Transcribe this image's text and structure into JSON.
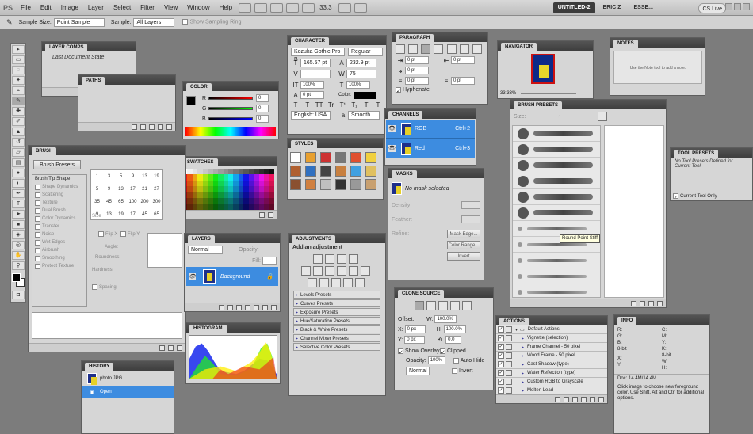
{
  "app": {
    "logo": "PS",
    "menu": [
      "File",
      "Edit",
      "Image",
      "Layer",
      "Select",
      "Filter",
      "View",
      "Window",
      "Help"
    ],
    "zoom": "33.3",
    "workspaces": [
      "UNTITLED-2",
      "ERIC Z",
      "ESSE..."
    ],
    "cslive": "CS Live"
  },
  "options": {
    "sample_size_label": "Sample Size:",
    "sample_size_value": "Point Sample",
    "sample_label": "Sample:",
    "sample_value": "All Layers",
    "show_ring": "Show Sampling Ring"
  },
  "layer_comps": {
    "title": "LAYER COMPS",
    "state": "Last Document State"
  },
  "paths": {
    "title": "PATHS"
  },
  "color": {
    "title": "COLOR",
    "values": [
      "0",
      "0",
      "0"
    ],
    "labels": [
      "R",
      "G",
      "B"
    ]
  },
  "swatches": {
    "title": "SWATCHES"
  },
  "brush": {
    "title": "BRUSH",
    "presets_button": "Brush Presets",
    "items": [
      "Brush Tip Shape",
      "Shape Dynamics",
      "Scattering",
      "Texture",
      "Dual Brush",
      "Color Dynamics",
      "Transfer",
      "Noise",
      "Wet Edges",
      "Airbrush",
      "Smoothing",
      "Protect Texture"
    ],
    "tip_sizes": [
      "1",
      "3",
      "5",
      "9",
      "13",
      "19",
      "5",
      "9",
      "13",
      "17",
      "21",
      "27",
      "35",
      "45",
      "65",
      "100",
      "200",
      "300",
      "9",
      "13",
      "19",
      "17",
      "45",
      "65"
    ],
    "size_label": "Size",
    "flip_x": "Flip X",
    "flip_y": "Flip Y",
    "angle": "Angle:",
    "roundness": "Roundness:",
    "hardness": "Hardness",
    "spacing": "Spacing"
  },
  "layers": {
    "title": "LAYERS",
    "blend": "Normal",
    "opacity_label": "Opacity:",
    "fill_label": "Fill:",
    "layer_name": "Background"
  },
  "histogram": {
    "title": "HISTOGRAM"
  },
  "history": {
    "title": "HISTORY",
    "doc": "photo.JPG",
    "step": "Open"
  },
  "character": {
    "title": "CHARACTER",
    "font": "Kozuka Gothic Pro B",
    "style": "Regular",
    "size": "165.57 pt",
    "leading": "232.9 pt",
    "kerning": "",
    "tracking": "75",
    "vscale": "100%",
    "hscale": "100%",
    "baseline": "0 pt",
    "color_label": "Color:",
    "lang": "English: USA",
    "aa": "Smooth",
    "tt_row": [
      "T",
      "T",
      "TT",
      "Tr",
      "T¹",
      "T₁",
      "T",
      "T"
    ]
  },
  "paragraph": {
    "title": "PARAGRAPH",
    "vals": [
      "0 pt",
      "0 pt",
      "0 pt",
      "0 pt",
      "0 pt"
    ],
    "hyphenate": "Hyphenate"
  },
  "styles": {
    "title": "STYLES"
  },
  "channels": {
    "title": "CHANNELS",
    "rows": [
      {
        "name": "RGB",
        "key": "Ctrl+2"
      },
      {
        "name": "Red",
        "key": "Ctrl+3"
      }
    ]
  },
  "masks": {
    "title": "MASKS",
    "status": "No mask selected",
    "density": "Density:",
    "feather": "Feather:",
    "refine": "Refine:",
    "mask_edge": "Mask Edge...",
    "color_range": "Color Range...",
    "invert": "Invert"
  },
  "adjustments": {
    "title": "ADJUSTMENTS",
    "subtitle": "Add an adjustment",
    "presets": [
      "Levels Presets",
      "Curves Presets",
      "Exposure Presets",
      "Hue/Saturation Presets",
      "Black & White Presets",
      "Channel Mixer Presets",
      "Selective Color Presets"
    ]
  },
  "clone_source": {
    "title": "CLONE SOURCE",
    "offset": "Offset:",
    "x": "0 px",
    "y": "0 px",
    "w": "100.0%",
    "h": "100.0%",
    "angle": "0.0",
    "show_overlay": "Show Overlay",
    "clipped": "Clipped",
    "opacity_label": "Opacity:",
    "opacity": "100%",
    "auto_hide": "Auto Hide",
    "mode": "Normal",
    "invert": "Invert"
  },
  "navigator": {
    "title": "NAVIGATOR",
    "zoom": "33.33%"
  },
  "notes": {
    "title": "NOTES",
    "hint": "Use the Note tool to add a note."
  },
  "brush_presets": {
    "title": "BRUSH PRESETS",
    "size_label": "Size:",
    "tooltip": "Round Point Stiff"
  },
  "tool_presets": {
    "title": "TOOL PRESETS",
    "empty": "No Tool Presets Defined for Current Tool.",
    "current_only": "Current Tool Only"
  },
  "actions": {
    "title": "ACTIONS",
    "set": "Default Actions",
    "items": [
      "Vignette (selection)",
      "Frame Channel - 50 pixel",
      "Wood Frame - 50 pixel",
      "Cast Shadow (type)",
      "Water Reflection (type)",
      "Custom RGB to Grayscale",
      "Molten Lead"
    ]
  },
  "info": {
    "title": "INFO",
    "labels_left": [
      "R:",
      "G:",
      "B:",
      "8-bit",
      "X:",
      "Y:"
    ],
    "labels_right": [
      "C:",
      "M:",
      "Y:",
      "K:",
      "8-bit",
      "W:",
      "H:"
    ],
    "doc": "Doc: 14.4M/14.4M",
    "hint": "Click image to choose new foreground color. Use Shift, Alt and Ctrl for additional options."
  }
}
